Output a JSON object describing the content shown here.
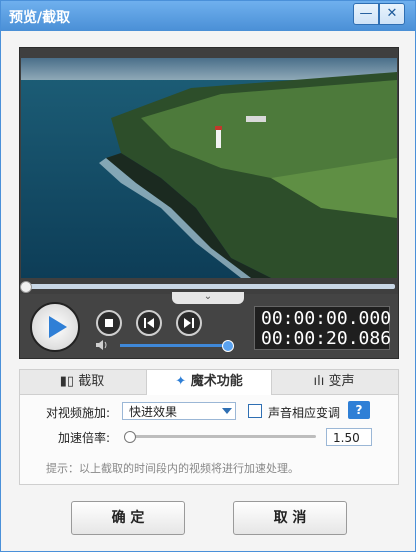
{
  "window": {
    "title": "预览/截取",
    "minimize": "—",
    "close": "✕"
  },
  "player": {
    "time_current": "00:00:00.000",
    "time_total": "00:00:20.086",
    "progress_fraction": 0.0,
    "volume_fraction": 1.0,
    "collapse_glyph": "⌄"
  },
  "tabs": [
    {
      "label": "截取"
    },
    {
      "label": "魔术功能"
    },
    {
      "label": "变声"
    }
  ],
  "magic": {
    "apply_label": "对视频施加:",
    "effect_value": "快进效果",
    "pitch_label": "声音相应变调",
    "pitch_checked": false,
    "help_label": "?",
    "speed_label": "加速倍率:",
    "speed_value": "1.50",
    "hint": "提示：以上截取的时间段内的视频将进行加速处理。"
  },
  "buttons": {
    "ok": "确 定",
    "cancel": "取 消"
  }
}
